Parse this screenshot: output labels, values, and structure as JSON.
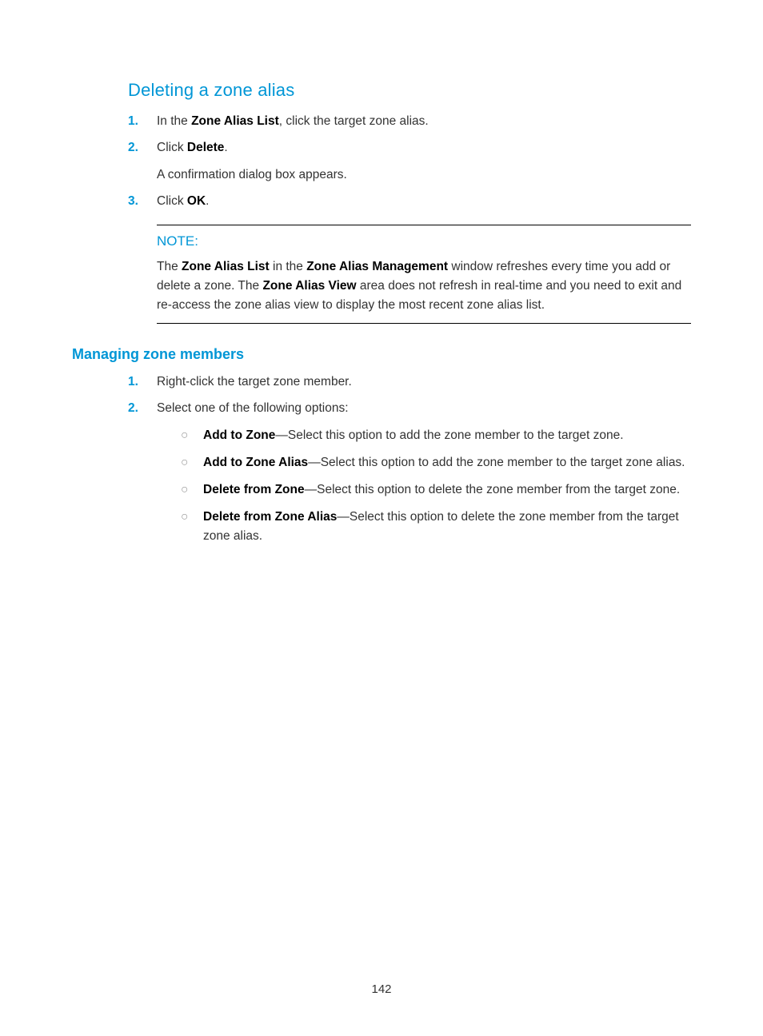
{
  "section1": {
    "title": "Deleting a zone alias",
    "steps": [
      {
        "num": "1.",
        "pre": "In the ",
        "bold": "Zone Alias List",
        "post": ", click the target zone alias."
      },
      {
        "num": "2.",
        "pre": "Click ",
        "bold": "Delete",
        "post": ".",
        "followup": "A confirmation dialog box appears."
      },
      {
        "num": "3.",
        "pre": "Click ",
        "bold": "OK",
        "post": "."
      }
    ]
  },
  "note": {
    "label": "NOTE:",
    "t1": "The ",
    "b1": "Zone Alias List",
    "t2": " in the ",
    "b2": "Zone Alias Management",
    "t3": " window refreshes every time you add or delete a zone. The ",
    "b3": "Zone Alias View",
    "t4": " area does not refresh in real-time and you need to exit and re-access the zone alias view to display the most recent zone alias list."
  },
  "section2": {
    "title": "Managing zone members",
    "steps": [
      {
        "num": "1.",
        "text": "Right-click the target zone member."
      },
      {
        "num": "2.",
        "text": "Select one of the following options:"
      }
    ],
    "options": [
      {
        "bold": "Add to Zone",
        "text": "—Select this option to add the zone member to the target zone."
      },
      {
        "bold": "Add to Zone Alias",
        "text": "—Select this option to add the zone member to the target zone alias."
      },
      {
        "bold": "Delete from Zone",
        "text": "—Select this option to delete the zone member from the target zone."
      },
      {
        "bold": "Delete from Zone Alias",
        "text": "—Select this option to delete the zone member from the target zone alias."
      }
    ]
  },
  "pageNumber": "142"
}
